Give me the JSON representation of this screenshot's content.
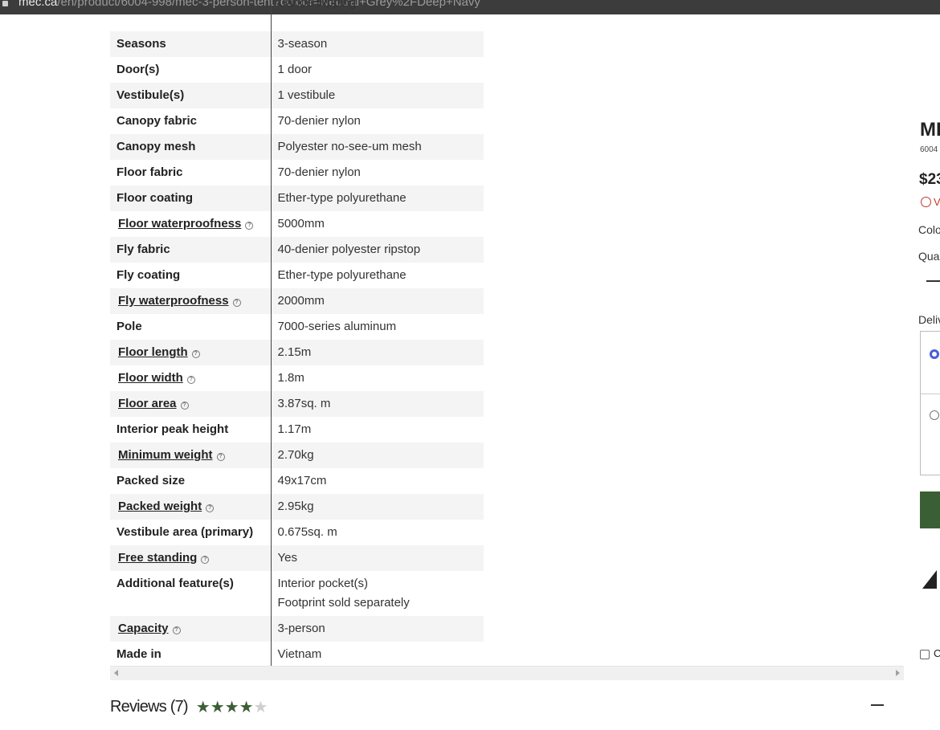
{
  "browser": {
    "url_host": "mec.ca",
    "url_path": "/en/product/6004-998/mec-3-person-tent?colour=Neutral+Grey%2FDeep+Navy"
  },
  "specs": {
    "partial_first_value": "Canoe tripping",
    "rows": [
      {
        "key": "Seasons",
        "value": "3-season",
        "info": false
      },
      {
        "key": "Door(s)",
        "value": "1 door",
        "info": false
      },
      {
        "key": "Vestibule(s)",
        "value": "1 vestibule",
        "info": false
      },
      {
        "key": "Canopy fabric",
        "value": "70-denier nylon",
        "info": false
      },
      {
        "key": "Canopy mesh",
        "value": "Polyester no-see-um mesh",
        "info": false
      },
      {
        "key": "Floor fabric",
        "value": "70-denier nylon",
        "info": false
      },
      {
        "key": "Floor coating",
        "value": "Ether-type polyurethane",
        "info": false
      },
      {
        "key": "Floor waterproofness",
        "value": "5000mm",
        "info": true
      },
      {
        "key": "Fly fabric",
        "value": "40-denier polyester ripstop",
        "info": false
      },
      {
        "key": "Fly coating",
        "value": "Ether-type polyurethane",
        "info": false
      },
      {
        "key": "Fly waterproofness",
        "value": "2000mm",
        "info": true
      },
      {
        "key": "Pole",
        "value": "7000-series aluminum",
        "info": false
      },
      {
        "key": "Floor length",
        "value": "2.15m",
        "info": true
      },
      {
        "key": "Floor width",
        "value": "1.8m",
        "info": true
      },
      {
        "key": "Floor area",
        "value": "3.87sq. m",
        "info": true
      },
      {
        "key": "Interior peak height",
        "value": "1.17m",
        "info": false
      },
      {
        "key": "Minimum weight",
        "value": "2.70kg",
        "info": true
      },
      {
        "key": "Packed size",
        "value": "49x17cm",
        "info": false
      },
      {
        "key": "Packed weight",
        "value": "2.95kg",
        "info": true
      },
      {
        "key": "Vestibule area (primary)",
        "value": "0.675sq. m",
        "info": false
      },
      {
        "key": "Free standing",
        "value": "Yes",
        "info": true
      },
      {
        "key": "Additional feature(s)",
        "value": "Interior pocket(s)",
        "value2": "Footprint sold separately",
        "info": false
      },
      {
        "key": "Capacity",
        "value": "3-person",
        "info": true
      },
      {
        "key": "Made in",
        "value": "Vietnam",
        "info": false
      }
    ]
  },
  "reviews": {
    "title": "Reviews (7)",
    "rating": 4,
    "max_rating": 5
  },
  "purchase_panel": {
    "title_partial": "MI",
    "product_code_partial": "6004",
    "price_partial": "$23",
    "warning_partial": "V",
    "colour_label_partial": "Colo",
    "quantity_label_partial": "Qua",
    "delivery_label_partial": "Deliv",
    "checkbox_label_partial": "C",
    "accent_color": "#3b5f34",
    "warning_color": "#c0392b"
  }
}
